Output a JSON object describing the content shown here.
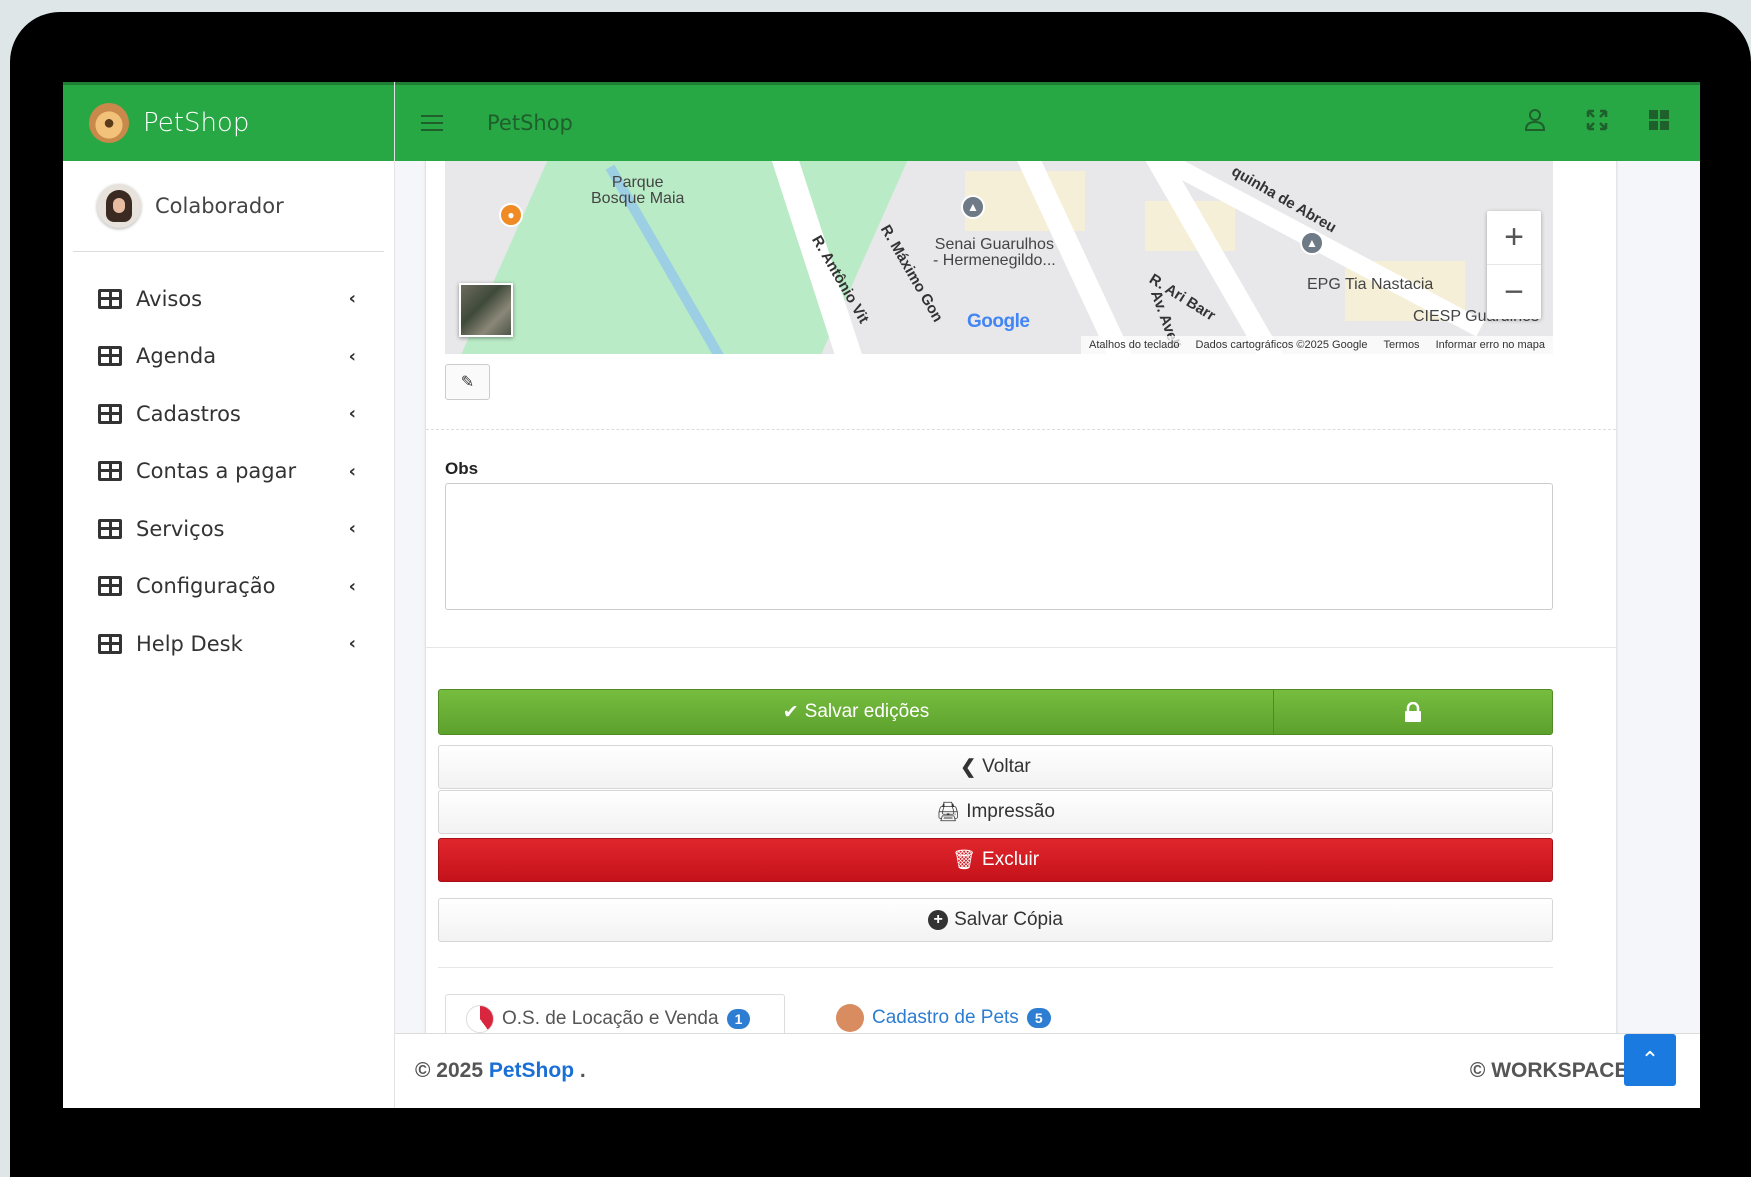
{
  "sidebar": {
    "brand": "PetShop",
    "user": "Colaborador",
    "items": [
      {
        "label": "Avisos"
      },
      {
        "label": "Agenda"
      },
      {
        "label": "Cadastros"
      },
      {
        "label": "Contas a pagar"
      },
      {
        "label": "Serviços"
      },
      {
        "label": "Configuração"
      },
      {
        "label": "Help Desk"
      }
    ]
  },
  "topbar": {
    "title": "PetShop"
  },
  "map": {
    "labels": {
      "park": "Parque\nBosque Maia",
      "senai": "Senai Guarulhos\n- Hermenegildo...",
      "epg": "EPG Tia Nastacia",
      "ciesp": "CIESP Guarulhos"
    },
    "streets": {
      "antonio": "R. Antônio Vit",
      "maximo": "R. Máximo Gon",
      "ari": "R. Ari Barr",
      "av": "Av. Aveli",
      "quinha": "quinha de Abreu"
    },
    "google": "Google",
    "footer": {
      "shortcuts": "Atalhos do teclado",
      "data": "Dados cartográficos ©2025 Google",
      "terms": "Termos",
      "report": "Informar erro no mapa"
    },
    "zoom_in": "+",
    "zoom_out": "−"
  },
  "form": {
    "obs_label": "Obs",
    "obs_value": ""
  },
  "buttons": {
    "save": "Salvar edições",
    "back": "Voltar",
    "print": "Impressão",
    "delete": "Excluir",
    "save_copy": "Salvar Cópia"
  },
  "tabs": [
    {
      "label": "O.S. de Locação e Venda",
      "count": "1"
    },
    {
      "label": "Cadastro de Pets",
      "count": "5"
    }
  ],
  "footer": {
    "year": "© 2025",
    "brand": "PetShop",
    "suffix": ".",
    "right": "© WORKSPACE Se"
  },
  "colors": {
    "primary_green": "#28a745",
    "save_green": "#6cb33a",
    "danger_red": "#d41b22",
    "link_blue": "#1a6fd6"
  }
}
